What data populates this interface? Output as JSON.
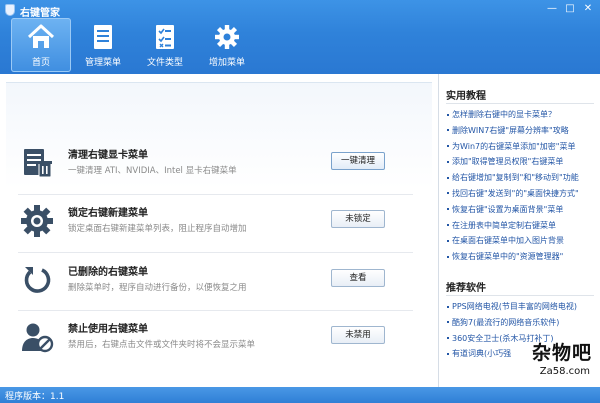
{
  "app": {
    "title": "右键管家"
  },
  "window_controls": {
    "minimize": "—",
    "maximize": "□",
    "close": "✕"
  },
  "nav": [
    {
      "label": "首页",
      "icon": "home-icon",
      "active": true
    },
    {
      "label": "管理菜单",
      "icon": "menu-list-icon",
      "active": false
    },
    {
      "label": "文件类型",
      "icon": "file-type-icon",
      "active": false
    },
    {
      "label": "增加菜单",
      "icon": "gear-icon",
      "active": false
    }
  ],
  "features": [
    {
      "title": "清理右键显卡菜单",
      "desc": "一键清理 ATI、NVIDIA、Intel 显卡右键菜单",
      "button": "一键清理",
      "icon": "cleanup-icon"
    },
    {
      "title": "锁定右键新建菜单",
      "desc": "锁定桌面右键新建菜单列表，阻止程序自动增加",
      "button": "未锁定",
      "icon": "settings-gear-icon"
    },
    {
      "title": "已删除的右键菜单",
      "desc": "删除菜单时，程序自动进行备份，以便恢复之用",
      "button": "查看",
      "icon": "restore-icon"
    },
    {
      "title": "禁止使用右键菜单",
      "desc": "禁用后，右键点击文件或文件夹时将不会显示菜单",
      "button": "未禁用",
      "icon": "disable-user-icon"
    }
  ],
  "sidebar": {
    "tutorials_title": "实用教程",
    "tutorials": [
      "怎样删除右键中的显卡菜单？",
      "删除WIN7右键\"屏幕分辨率\"攻略",
      "为Win7的右键菜单添加\"加密\"菜单",
      "添加\"取得管理员权限\"右键菜单",
      "给右键增加\"复制到\"和\"移动到\"功能",
      "找回右键\"发送到\"的\"桌面快捷方式\"",
      "恢复右键\"设置为桌面背景\"菜单",
      "在注册表中简单定制右键菜单",
      "在桌面右键菜单中加入图片背景",
      "恢复右键菜单中的\"资源管理器\""
    ],
    "software_title": "推荐软件",
    "software": [
      "PPS网络电视(节目丰富的网络电视)",
      "酷狗7(最流行的网络音乐软件)",
      "360安全卫士(杀木马打补丁)",
      "有道词典(小巧强"
    ]
  },
  "watermark": {
    "main": "杂物吧",
    "sub": "Za58.com"
  },
  "status": {
    "version_text": "程序版本：1.1"
  },
  "colors": {
    "header_blue": "#2f82da",
    "link_blue": "#2356a6",
    "status_blue": "#3a88dc"
  }
}
